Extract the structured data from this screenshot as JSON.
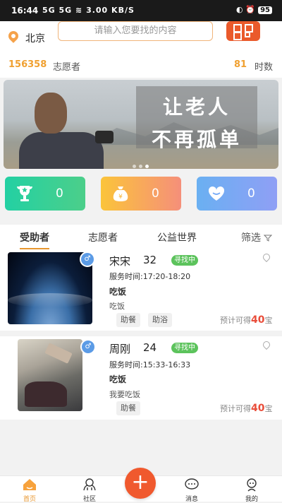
{
  "status_bar": {
    "time": "16:44",
    "signal": "5G 5G ≋ 3.00 KB/S",
    "battery": "95"
  },
  "header": {
    "city": "北京",
    "search_placeholder": "请输入您要找的内容"
  },
  "stats": {
    "volunteer_count": "156358",
    "volunteer_label": "志愿者",
    "hours_count": "81",
    "hours_label": "时数"
  },
  "banner": {
    "line1": "让老人",
    "line2": "不再孤单",
    "page_count": 3,
    "active_page": 3
  },
  "cards": [
    {
      "icon": "trophy-icon",
      "value": "0",
      "color": "#2ecf9a"
    },
    {
      "icon": "money-bag-icon",
      "value": "0",
      "color": "#f7b53a"
    },
    {
      "icon": "heart-icon",
      "value": "0",
      "color": "#6fa6f7"
    }
  ],
  "tabs": {
    "recipients": "受助者",
    "volunteers": "志愿者",
    "charity_world": "公益世界",
    "filter": "筛选"
  },
  "list": [
    {
      "name": "宋宋",
      "age": "32",
      "status": "寻找中",
      "service_time": "服务时间:17:20-18:20",
      "need": "吃饭",
      "desc": "吃饭",
      "tags": [
        "助餐",
        "助浴"
      ],
      "reward_prefix": "预计可得",
      "reward_value": "40",
      "reward_unit": "宝"
    },
    {
      "name": "周刚",
      "age": "24",
      "status": "寻找中",
      "service_time": "服务时间:15:33-16:33",
      "need": "吃饭",
      "desc": "我要吃饭",
      "tags": [
        "助餐"
      ],
      "reward_prefix": "预计可得",
      "reward_value": "40",
      "reward_unit": "宝"
    }
  ],
  "tabbar": {
    "home": "首页",
    "community": "社区",
    "add": "+",
    "messages": "消息",
    "mine": "我的"
  }
}
